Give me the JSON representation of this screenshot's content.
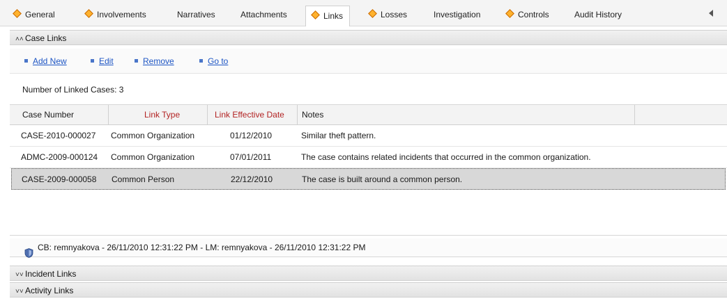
{
  "tabs": [
    {
      "label": "General",
      "marker": true
    },
    {
      "label": "Involvements",
      "marker": true
    },
    {
      "label": "Narratives",
      "marker": false
    },
    {
      "label": "Attachments",
      "marker": false
    },
    {
      "label": "Links",
      "marker": true,
      "active": true
    },
    {
      "label": "Losses",
      "marker": true
    },
    {
      "label": "Investigation",
      "marker": false
    },
    {
      "label": "Controls",
      "marker": true
    },
    {
      "label": "Audit History",
      "marker": false
    }
  ],
  "case_links": {
    "title": "Case Links",
    "actions": [
      "Add New",
      "Edit",
      "Remove",
      "Go to"
    ],
    "count_label": "Number of Linked Cases: 3",
    "columns": [
      "Case Number",
      "Link Type",
      "Link Effective Date",
      "Notes"
    ],
    "rows": [
      {
        "case_number": "CASE-2010-000027",
        "link_type": "Common Organization",
        "date": "01/12/2010",
        "notes": "Similar theft pattern."
      },
      {
        "case_number": "ADMC-2009-000124",
        "link_type": "Common Organization",
        "date": "07/01/2011",
        "notes": "The case contains related incidents that occurred in the common organization."
      },
      {
        "case_number": "CASE-2009-000058",
        "link_type": "Common Person",
        "date": "22/12/2010",
        "notes": "The case is built around a common person.",
        "selected": true
      }
    ],
    "audit_text": "CB: remnyakova - 26/11/2010 12:31:22 PM - LM: remnyakova - 26/11/2010 12:31:22 PM"
  },
  "sections": [
    {
      "title": "Incident Links"
    },
    {
      "title": "Activity Links"
    }
  ],
  "colors": {
    "link_blue": "#1d55c4",
    "required_header": "#b22222",
    "marker_orange": "#ffb22e",
    "selected_row": "#d8d8d8"
  }
}
